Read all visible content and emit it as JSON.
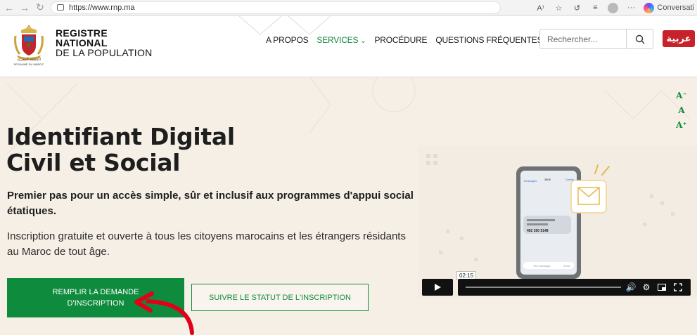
{
  "browser": {
    "url": "https://www.rnp.ma",
    "conversation_label": "Conversati",
    "icons": [
      "back-icon",
      "forward-icon",
      "reload-icon",
      "page-icon",
      "read-aloud-icon",
      "favorite-icon",
      "sync-icon",
      "collections-icon",
      "profile-icon",
      "more-icon",
      "copilot-icon"
    ],
    "read_aloud_label": "A⁾"
  },
  "header": {
    "brand_line1": "REGISTRE",
    "brand_line2": "NATIONAL",
    "brand_line3": "DE LA POPULATION",
    "emblem_caption_ar": "المملكة المغربية",
    "emblem_caption_fr": "ROYAUME DU MAROC",
    "menu": [
      {
        "label": "A PROPOS",
        "active": false
      },
      {
        "label": "SERVICES",
        "active": true,
        "dropdown": true
      },
      {
        "label": "PROCÉDURE",
        "active": false
      },
      {
        "label": "QUESTIONS FRÉQUENTES",
        "active": false
      }
    ],
    "search_placeholder": "Rechercher...",
    "lang_button": "عربية"
  },
  "hero": {
    "title_line1": "Identifiant Digital",
    "title_line2": "Civil et Social",
    "subtitle": "Premier pas pour un accès simple, sûr et inclusif aux programmes d'appui social étatiques.",
    "description": "Inscription gratuite et ouverte à tous les citoyens marocains et les étrangers résidants au Maroc de tout âge.",
    "cta_primary": "REMPLIR LA DEMANDE D'INSCRIPTION",
    "cta_secondary": "SUIVRE LE STATUT DE L'INSCRIPTION"
  },
  "font_tools": [
    "A⁻",
    "A",
    "A⁺"
  ],
  "video": {
    "timestamp": "02:15",
    "phone_text": "462 350 5148",
    "phone_header_left": "Messages",
    "phone_header_mid": "3806",
    "phone_header_right": "Details",
    "phone_input_placeholder": "Text Message",
    "phone_send_label": "Send"
  },
  "colors": {
    "primary_green": "#0f8b3e",
    "lang_red": "#c52229",
    "background": "#f6efe6",
    "arrow_red": "#e0001a"
  }
}
